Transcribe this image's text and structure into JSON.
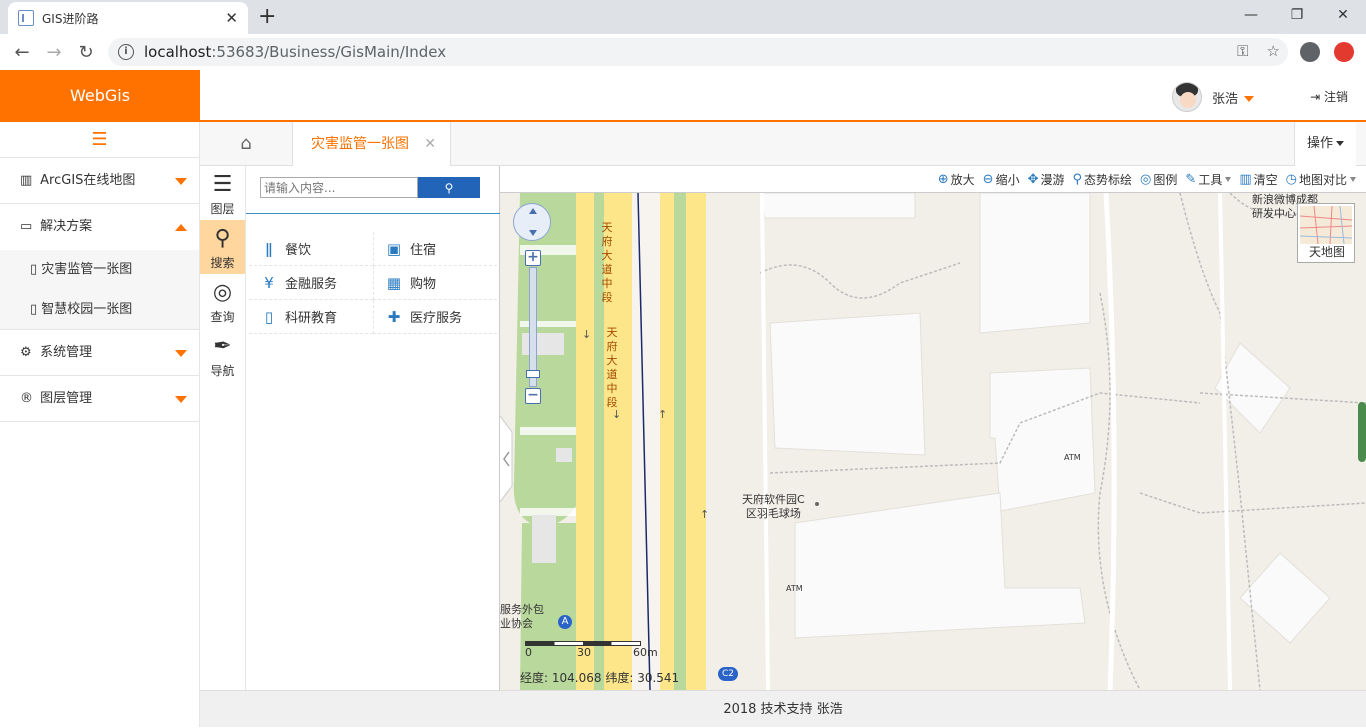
{
  "browser": {
    "tab_title": "GIS进阶路",
    "url_host": "localhost",
    "url_path": ":53683/Business/GisMain/Index"
  },
  "app": {
    "brand": "WebGis",
    "user_name": "张浩",
    "logout": "注销",
    "footer": "2018 技术支持 张浩"
  },
  "sidebar": {
    "items": [
      {
        "label": "ArcGIS在线地图",
        "icon": "map-icon",
        "expanded": false
      },
      {
        "label": "解决方案",
        "icon": "laptop-icon",
        "expanded": true
      },
      {
        "label": "系统管理",
        "icon": "gears-icon",
        "expanded": false
      },
      {
        "label": "图层管理",
        "icon": "registered-icon",
        "expanded": false
      }
    ],
    "sub_items": [
      {
        "label": "灾害监管一张图",
        "icon": "map-outline-icon"
      },
      {
        "label": "智慧校园一张图",
        "icon": "map-outline-icon"
      }
    ]
  },
  "tabs": {
    "active": "灾害监管一张图",
    "ops": "操作"
  },
  "vtools": [
    {
      "label": "图层",
      "icon": "layers-icon"
    },
    {
      "label": "搜索",
      "icon": "search-icon",
      "active": true
    },
    {
      "label": "查询",
      "icon": "globe-icon"
    },
    {
      "label": "导航",
      "icon": "pen-icon"
    }
  ],
  "search": {
    "placeholder": "请输入内容...",
    "categories": [
      {
        "label": "餐饮",
        "icon": "cutlery-icon"
      },
      {
        "label": "住宿",
        "icon": "train-icon"
      },
      {
        "label": "金融服务",
        "icon": "yen-icon"
      },
      {
        "label": "购物",
        "icon": "cart-icon"
      },
      {
        "label": "科研教育",
        "icon": "book-icon"
      },
      {
        "label": "医疗服务",
        "icon": "medical-icon"
      }
    ]
  },
  "map_toolbar": [
    {
      "label": "放大",
      "icon": "zoom-in-icon"
    },
    {
      "label": "缩小",
      "icon": "zoom-out-icon"
    },
    {
      "label": "漫游",
      "icon": "move-icon"
    },
    {
      "label": "态势标绘",
      "icon": "pin-icon"
    },
    {
      "label": "图例",
      "icon": "globe-icon"
    },
    {
      "label": "工具",
      "icon": "wrench-icon",
      "dropdown": true
    },
    {
      "label": "清空",
      "icon": "trash-icon"
    },
    {
      "label": "地图对比",
      "icon": "clock-icon",
      "dropdown": true
    }
  ],
  "map": {
    "basemap_label": "天地图",
    "road_label_1": "天府大道中段",
    "road_label_2": "天府大道中段",
    "poi_1_line1": "新浪微博成都",
    "poi_1_line2": "研发中心",
    "poi_2_line1": "天府软件园C",
    "poi_2_line2": "区羽毛球场",
    "poi_3_line1": "服务外包",
    "poi_3_line2": "业协会",
    "atm_1": "ATM",
    "atm_2": "ATM",
    "metro_a": "A",
    "metro_c2": "C2",
    "scale_0": "0",
    "scale_30": "30",
    "scale_60": "60m",
    "lon_label": "经度:",
    "lon": "104.068",
    "lat_label": "纬度:",
    "lat": "30.541"
  },
  "colors": {
    "accent": "#ff7200",
    "link_blue": "#2a7ac0",
    "search_btn": "#2264b8"
  }
}
